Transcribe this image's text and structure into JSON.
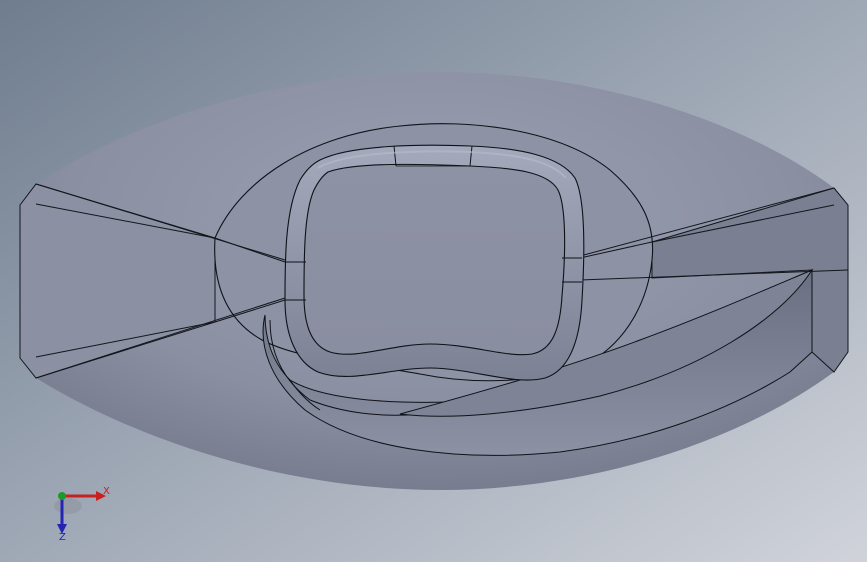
{
  "viewport": {
    "background_top": "#7d8a9a",
    "background_bottom": "#c9cdd5",
    "model_color": "#8f94a6",
    "edge_color": "#111318"
  },
  "triad": {
    "x_label": "X",
    "z_label": "Z",
    "x_color": "#c8201e",
    "y_color": "#1e9a2a",
    "z_color": "#2424b4"
  }
}
